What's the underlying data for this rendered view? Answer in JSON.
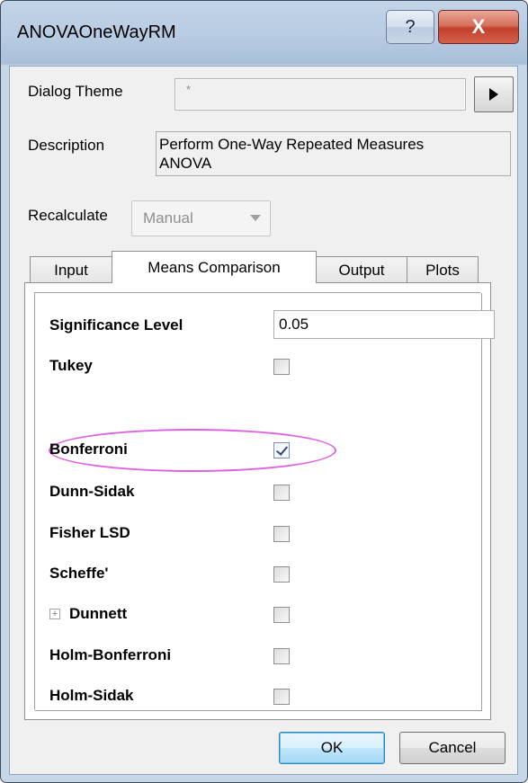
{
  "window": {
    "title": "ANOVAOneWayRM",
    "help_glyph": "?",
    "close_glyph": "X"
  },
  "dialog_theme": {
    "label": "Dialog Theme",
    "value": "*"
  },
  "description": {
    "label": "Description",
    "text_line1": "Perform One-Way Repeated Measures",
    "text_line2": "ANOVA"
  },
  "recalculate": {
    "label": "Recalculate",
    "value": "Manual"
  },
  "tabs": [
    {
      "label": "Input",
      "active": false
    },
    {
      "label": "Means Comparison",
      "active": true
    },
    {
      "label": "Output",
      "active": false
    },
    {
      "label": "Plots",
      "active": false
    }
  ],
  "means_comparison": {
    "significance_level_label": "Significance Level",
    "significance_level_value": "0.05",
    "options": [
      {
        "label": "Tukey",
        "checked": false
      },
      {
        "label": "Bonferroni",
        "checked": true
      },
      {
        "label": "Dunn-Sidak",
        "checked": false
      },
      {
        "label": "Fisher LSD",
        "checked": false
      },
      {
        "label": "Scheffe'",
        "checked": false
      },
      {
        "label": "Dunnett",
        "checked": false,
        "expandable": true
      },
      {
        "label": "Holm-Bonferroni",
        "checked": false
      },
      {
        "label": "Holm-Sidak",
        "checked": false
      }
    ]
  },
  "buttons": {
    "ok": "OK",
    "cancel": "Cancel"
  },
  "colors": {
    "highlight_ellipse": "#e05ee3",
    "close_button": "#c2402a"
  }
}
